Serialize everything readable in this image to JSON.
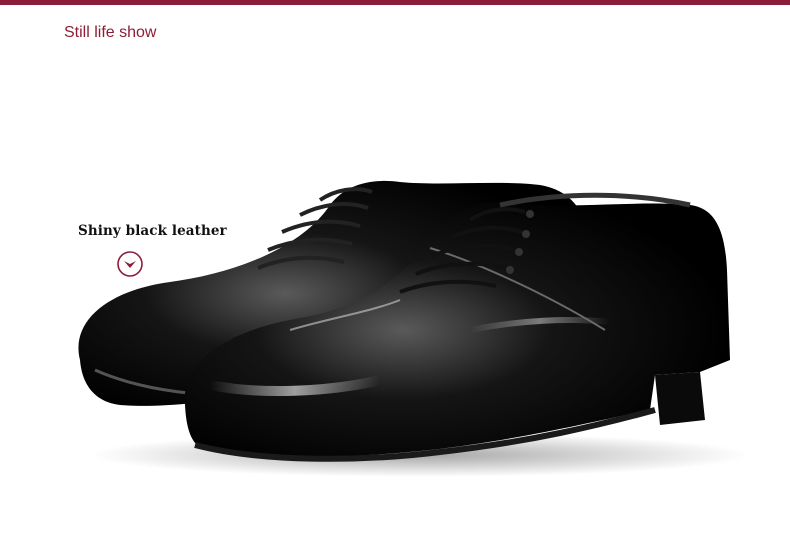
{
  "header": {
    "title": "Still life show",
    "accent_color": "#8c1d3a"
  },
  "feature": {
    "label": "Shiny black leather",
    "pointer_icon": "chevron-down-circle-icon"
  },
  "product": {
    "image_subject": "shoe-image"
  }
}
